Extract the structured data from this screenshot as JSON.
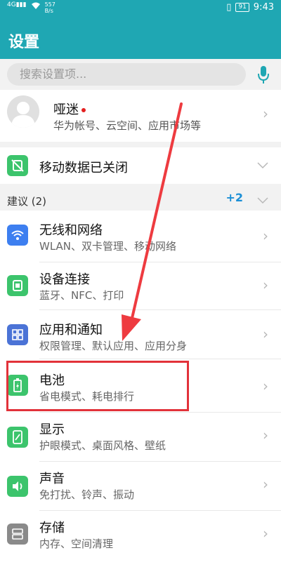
{
  "status_bar": {
    "net_speed_line1": "557",
    "net_speed_line2": "B/s",
    "signal_label": "4G",
    "battery": "91",
    "time": "9:43"
  },
  "header": {
    "title": "设置"
  },
  "search": {
    "placeholder": "搜索设置项..."
  },
  "account": {
    "name": "哑迷",
    "description": "华为帐号、云空间、应用市场等"
  },
  "mobile_data": {
    "label": "移动数据已关闭"
  },
  "suggestions": {
    "label": "建议 (2)",
    "more": "+2"
  },
  "settings": [
    {
      "label": "无线和网络",
      "sub": "WLAN、双卡管理、移动网络"
    },
    {
      "label": "设备连接",
      "sub": "蓝牙、NFC、打印"
    },
    {
      "label": "应用和通知",
      "sub": "权限管理、默认应用、应用分身"
    },
    {
      "label": "电池",
      "sub": "省电模式、耗电排行"
    },
    {
      "label": "显示",
      "sub": "护眼模式、桌面风格、壁纸"
    },
    {
      "label": "声音",
      "sub": "免打扰、铃声、振动"
    },
    {
      "label": "存储",
      "sub": "内存、空间清理"
    }
  ],
  "colors": {
    "header": "#1fa7b3",
    "wifi_icon": "#3d7ff0",
    "green_icon": "#3cc46c",
    "grid_icon": "#4b73d6",
    "storage_icon": "#8a8a8a",
    "highlight": "#e2323a",
    "arrow": "#ee3b40",
    "plus": "#1b8fd6"
  }
}
